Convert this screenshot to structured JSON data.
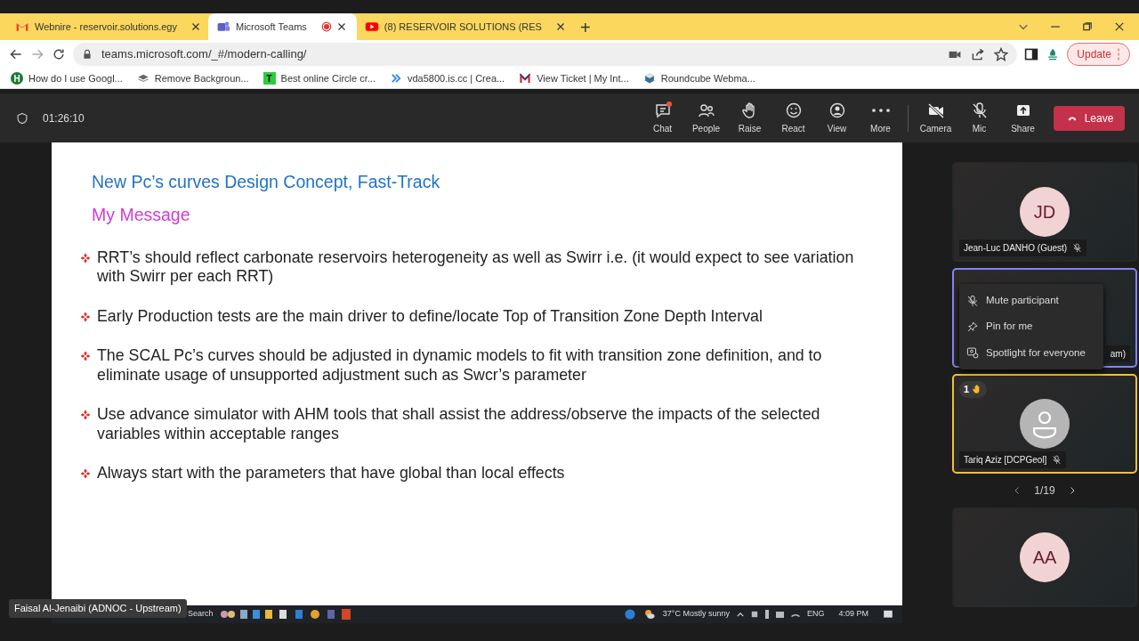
{
  "browser": {
    "tabs": [
      {
        "title": "Webnire - reservoir.solutions.egy",
        "kind": "gmail",
        "selected": false,
        "recording": false
      },
      {
        "title": "Microsoft Teams",
        "kind": "teams",
        "selected": true,
        "recording": true
      },
      {
        "title": "(8) RESERVOIR SOLUTIONS (RES",
        "kind": "youtube",
        "selected": false,
        "recording": false
      }
    ],
    "new_tab": "+",
    "url": "teams.microsoft.com/_#/modern-calling/",
    "update_button": "Update",
    "bookmarks": [
      {
        "label": "How do I use Googl...",
        "kind": "letter-circle",
        "letter": "H"
      },
      {
        "label": "Remove Backgroun...",
        "kind": "layers"
      },
      {
        "label": "Best online Circle cr...",
        "kind": "letter-square",
        "letter": "T"
      },
      {
        "label": "vda5800.is.cc | Crea...",
        "kind": "chevrons"
      },
      {
        "label": "View Ticket | My Int...",
        "kind": "m-logo"
      },
      {
        "label": "Roundcube Webma...",
        "kind": "cube"
      }
    ]
  },
  "meeting": {
    "timer": "01:26:10",
    "toolbar": [
      {
        "label": "Chat",
        "kind": "chat",
        "notification": true
      },
      {
        "label": "People",
        "kind": "people",
        "notification": false
      },
      {
        "label": "Raise",
        "kind": "hand",
        "notification": false
      },
      {
        "label": "React",
        "kind": "smiley",
        "notification": false
      },
      {
        "label": "View",
        "kind": "view",
        "notification": false
      },
      {
        "label": "More",
        "kind": "dots",
        "notification": false
      }
    ],
    "devices": [
      {
        "label": "Camera",
        "kind": "camera-off"
      },
      {
        "label": "Mic",
        "kind": "mic-off"
      },
      {
        "label": "Share",
        "kind": "share"
      }
    ],
    "leave_button": "Leave"
  },
  "slide": {
    "title": "New Pc’s curves Design Concept, Fast-Track",
    "subtitle": "My Message",
    "bullets": [
      "RRT’s should reflect carbonate reservoirs heterogeneity as well as Swirr i.e. (it would expect to see variation with Swirr per each RRT)",
      "Early Production tests are the main driver to define/locate Top of Transition Zone Depth Interval",
      "The SCAL Pc’s curves should be adjusted in dynamic models to fit with transition zone definition, and to eliminate usage of unsupported adjustment such as Swcr’s parameter",
      "Use advance simulator with AHM tools that shall assist the address/observe the impacts of the selected variables within acceptable ranges",
      "Always start with the parameters that have global than local effects"
    ],
    "taskbar": {
      "search": "Search",
      "weather": "37°C Mostly sunny",
      "language": "ENG",
      "time": "4:09 PM"
    }
  },
  "presenter_label": "Faisal Al-Jenaibi (ADNOC - Upstream)",
  "participants": {
    "tiles": [
      {
        "initials": "JD",
        "name": "Jean-Luc DANHO (Guest)",
        "muted": true,
        "focused": false,
        "hand_raised": false
      },
      {
        "name": "am)",
        "muted": false,
        "focused": true,
        "hand_raised": false,
        "menu": [
          {
            "label": "Mute participant",
            "kind": "mic-off"
          },
          {
            "label": "Pin for me",
            "kind": "pin"
          },
          {
            "label": "Spotlight for everyone",
            "kind": "spotlight"
          }
        ]
      },
      {
        "name": "Tariq Aziz [DCPGeol]",
        "muted": true,
        "focused": false,
        "hand_raised": true,
        "raised_count": "1"
      },
      {
        "initials": "AA",
        "focused": false,
        "hand_raised": false
      }
    ],
    "pager": "1/19"
  }
}
